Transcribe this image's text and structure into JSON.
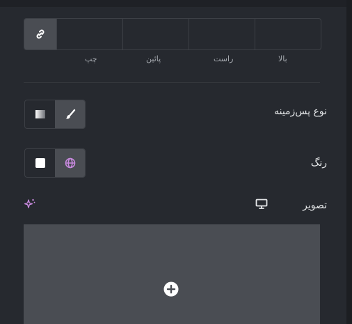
{
  "dimensions": {
    "labels": {
      "left": "چپ",
      "bottom": "پائین",
      "right": "راست",
      "top": "بالا"
    }
  },
  "background_type": {
    "label": "نوع پس‌زمینه"
  },
  "color": {
    "label": "رنگ"
  },
  "image": {
    "label": "تصویر"
  },
  "colors": {
    "accent": "#c98ae0",
    "panel_bg": "#26292f",
    "active_seg": "#4a4d53"
  },
  "icons": [
    "link-icon",
    "gradient-icon",
    "brush-icon",
    "square-icon",
    "globe-icon",
    "sparkle-icon",
    "monitor-icon",
    "plus-circle-icon"
  ]
}
